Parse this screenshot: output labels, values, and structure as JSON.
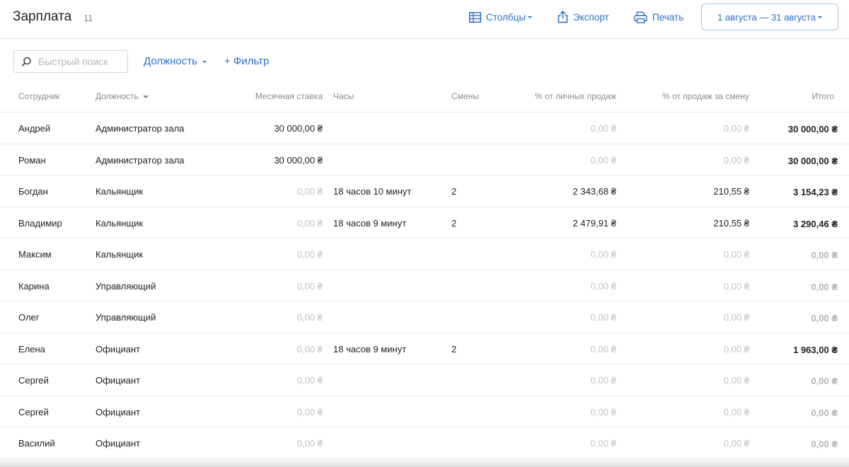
{
  "header": {
    "title": "Зарплата",
    "count": "11",
    "columns_label": "Столбцы",
    "export_label": "Экспорт",
    "print_label": "Печать",
    "date_range": "1 августа — 31 августа"
  },
  "toolbar": {
    "search_placeholder": "Быстрый поиск",
    "position_filter": "Должность",
    "add_filter": "+ Фильтр"
  },
  "colors": {
    "accent": "#2d6fc7",
    "muted": "#c2c2c2",
    "border": "#e4e4e4"
  },
  "table": {
    "headers": {
      "employee": "Сотрудник",
      "position": "Должность",
      "rate": "Месячная ставка",
      "hours": "Часы",
      "shifts": "Смены",
      "personal_sales": "% от личных продаж",
      "shift_sales": "% от продаж за смену",
      "total": "Итого"
    },
    "rows": [
      {
        "name": "Андрей",
        "position": "Администратор зала",
        "rate": "30 000,00 ₴",
        "hours": "",
        "shifts": "",
        "personal": "0,00 ₴",
        "shift": "0,00 ₴",
        "total": "30 000,00 ₴"
      },
      {
        "name": "Роман",
        "position": "Администратор зала",
        "rate": "30 000,00 ₴",
        "hours": "",
        "shifts": "",
        "personal": "0,00 ₴",
        "shift": "0,00 ₴",
        "total": "30 000,00 ₴"
      },
      {
        "name": "Богдан",
        "position": "Кальянщик",
        "rate": "0,00 ₴",
        "hours": "18 часов 10 минут",
        "shifts": "2",
        "personal": "2 343,68 ₴",
        "shift": "210,55 ₴",
        "total": "3 154,23 ₴"
      },
      {
        "name": "Владимир",
        "position": "Кальянщик",
        "rate": "0,00 ₴",
        "hours": "18 часов 9 минут",
        "shifts": "2",
        "personal": "2 479,91 ₴",
        "shift": "210,55 ₴",
        "total": "3 290,46 ₴"
      },
      {
        "name": "Максим",
        "position": "Кальянщик",
        "rate": "0,00 ₴",
        "hours": "",
        "shifts": "",
        "personal": "0,00 ₴",
        "shift": "0,00 ₴",
        "total": "0,00 ₴"
      },
      {
        "name": "Карина",
        "position": "Управляющий",
        "rate": "0,00 ₴",
        "hours": "",
        "shifts": "",
        "personal": "0,00 ₴",
        "shift": "0,00 ₴",
        "total": "0,00 ₴"
      },
      {
        "name": "Олег",
        "position": "Управляющий",
        "rate": "0,00 ₴",
        "hours": "",
        "shifts": "",
        "personal": "0,00 ₴",
        "shift": "0,00 ₴",
        "total": "0,00 ₴"
      },
      {
        "name": "Елена",
        "position": "Официант",
        "rate": "0,00 ₴",
        "hours": "18 часов 9 минут",
        "shifts": "2",
        "personal": "0,00 ₴",
        "shift": "0,00 ₴",
        "total": "1 963,00 ₴"
      },
      {
        "name": "Сергей",
        "position": "Официант",
        "rate": "0,00 ₴",
        "hours": "",
        "shifts": "",
        "personal": "0,00 ₴",
        "shift": "0,00 ₴",
        "total": "0,00 ₴"
      },
      {
        "name": "Сергей",
        "position": "Официант",
        "rate": "0,00 ₴",
        "hours": "",
        "shifts": "",
        "personal": "0,00 ₴",
        "shift": "0,00 ₴",
        "total": "0,00 ₴"
      },
      {
        "name": "Василий",
        "position": "Официант",
        "rate": "0,00 ₴",
        "hours": "",
        "shifts": "",
        "personal": "0,00 ₴",
        "shift": "0,00 ₴",
        "total": "0,00 ₴"
      }
    ]
  }
}
